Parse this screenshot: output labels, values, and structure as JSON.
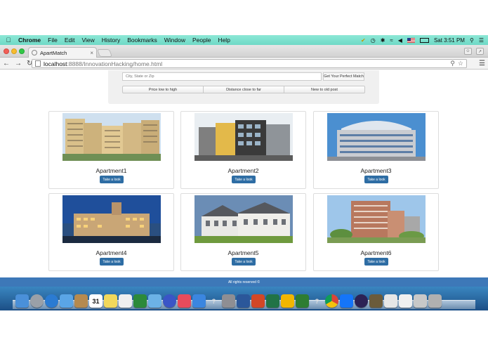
{
  "menubar": {
    "app": "Chrome",
    "items": [
      "File",
      "Edit",
      "View",
      "History",
      "Bookmarks",
      "Window",
      "People",
      "Help"
    ],
    "clock": "Sat 3:51 PM"
  },
  "browser": {
    "tab_title": "ApartMatch",
    "tab_close": "×",
    "url_host": "localhost",
    "url_path": ":8888/InnovationHacking/home.html"
  },
  "search": {
    "placeholder": "City, State or Zip",
    "button_label": "Get Your Perfect Match",
    "sort_options": [
      "Price low to high",
      "Distance close to far",
      "New to old post"
    ]
  },
  "listings": [
    {
      "title": "Apartment1",
      "button": "Take a look"
    },
    {
      "title": "Apartment2",
      "button": "Take a look"
    },
    {
      "title": "Apartment3",
      "button": "Take a look"
    },
    {
      "title": "Apartment4",
      "button": "Take a look"
    },
    {
      "title": "Apartment5",
      "button": "Take a look"
    },
    {
      "title": "Apartment6",
      "button": "Take a look"
    }
  ],
  "footer": {
    "text": "All rights reserved ©"
  },
  "dock": {
    "calendar_day": "31",
    "icons": [
      "finder-icon",
      "launchpad-icon",
      "safari-icon",
      "mail-icon",
      "contacts-icon",
      "calendar-icon",
      "notes-icon",
      "reminders-icon",
      "facetime-icon",
      "preview-icon",
      "itunes-icon",
      "music-icon",
      "app-store-icon",
      "help-icon",
      "system-preferences-icon",
      "word-icon",
      "powerpoint-icon",
      "excel-icon",
      "outlook-icon",
      "download-icon",
      "help-icon",
      "chrome-icon",
      "xcode-icon",
      "eclipse-icon",
      "script-icon",
      "document-icon",
      "screenshot-icon",
      "folder-icon",
      "trash-icon"
    ],
    "colors": [
      "#4a90d9",
      "#9aa0a8",
      "#2b7bd2",
      "#5aa5e6",
      "#b58a4f",
      "#ffffff",
      "#f1d85b",
      "#efefef",
      "#2c8a3a",
      "#6cb2e6",
      "#3a55c7",
      "#e84b5c",
      "#3b86e0",
      "#999999",
      "#8e8e93",
      "#2b579a",
      "#d24726",
      "#217346",
      "#f2b600",
      "#2e7d32",
      "#999999",
      "#ffffff",
      "#1575f9",
      "#2c2255",
      "#6b5b3b",
      "#e6e6e6",
      "#f0f0f0",
      "#c8c8c8",
      "#b0b0b0"
    ]
  }
}
